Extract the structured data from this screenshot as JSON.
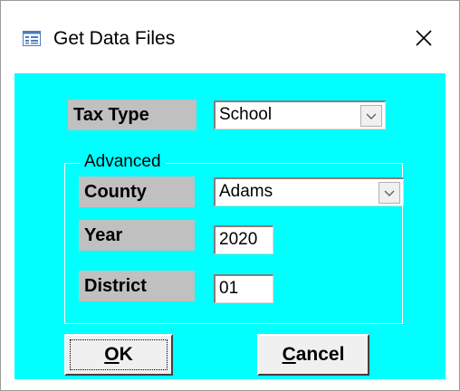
{
  "window": {
    "title": "Get Data Files",
    "close_symbol": "✕",
    "icon": "form-icon"
  },
  "form": {
    "tax_type": {
      "label": "Tax Type",
      "value": "School"
    },
    "advanced": {
      "legend": "Advanced",
      "county": {
        "label": "County",
        "value": "Adams"
      },
      "year": {
        "label": "Year",
        "value": "2020"
      },
      "district": {
        "label": "District",
        "value": "01"
      }
    }
  },
  "buttons": {
    "ok": {
      "mnemonic": "O",
      "rest": "K"
    },
    "cancel": {
      "mnemonic": "C",
      "rest": "ancel"
    }
  },
  "colors": {
    "background": "#00ffff",
    "label_background": "#c0c0c0"
  }
}
